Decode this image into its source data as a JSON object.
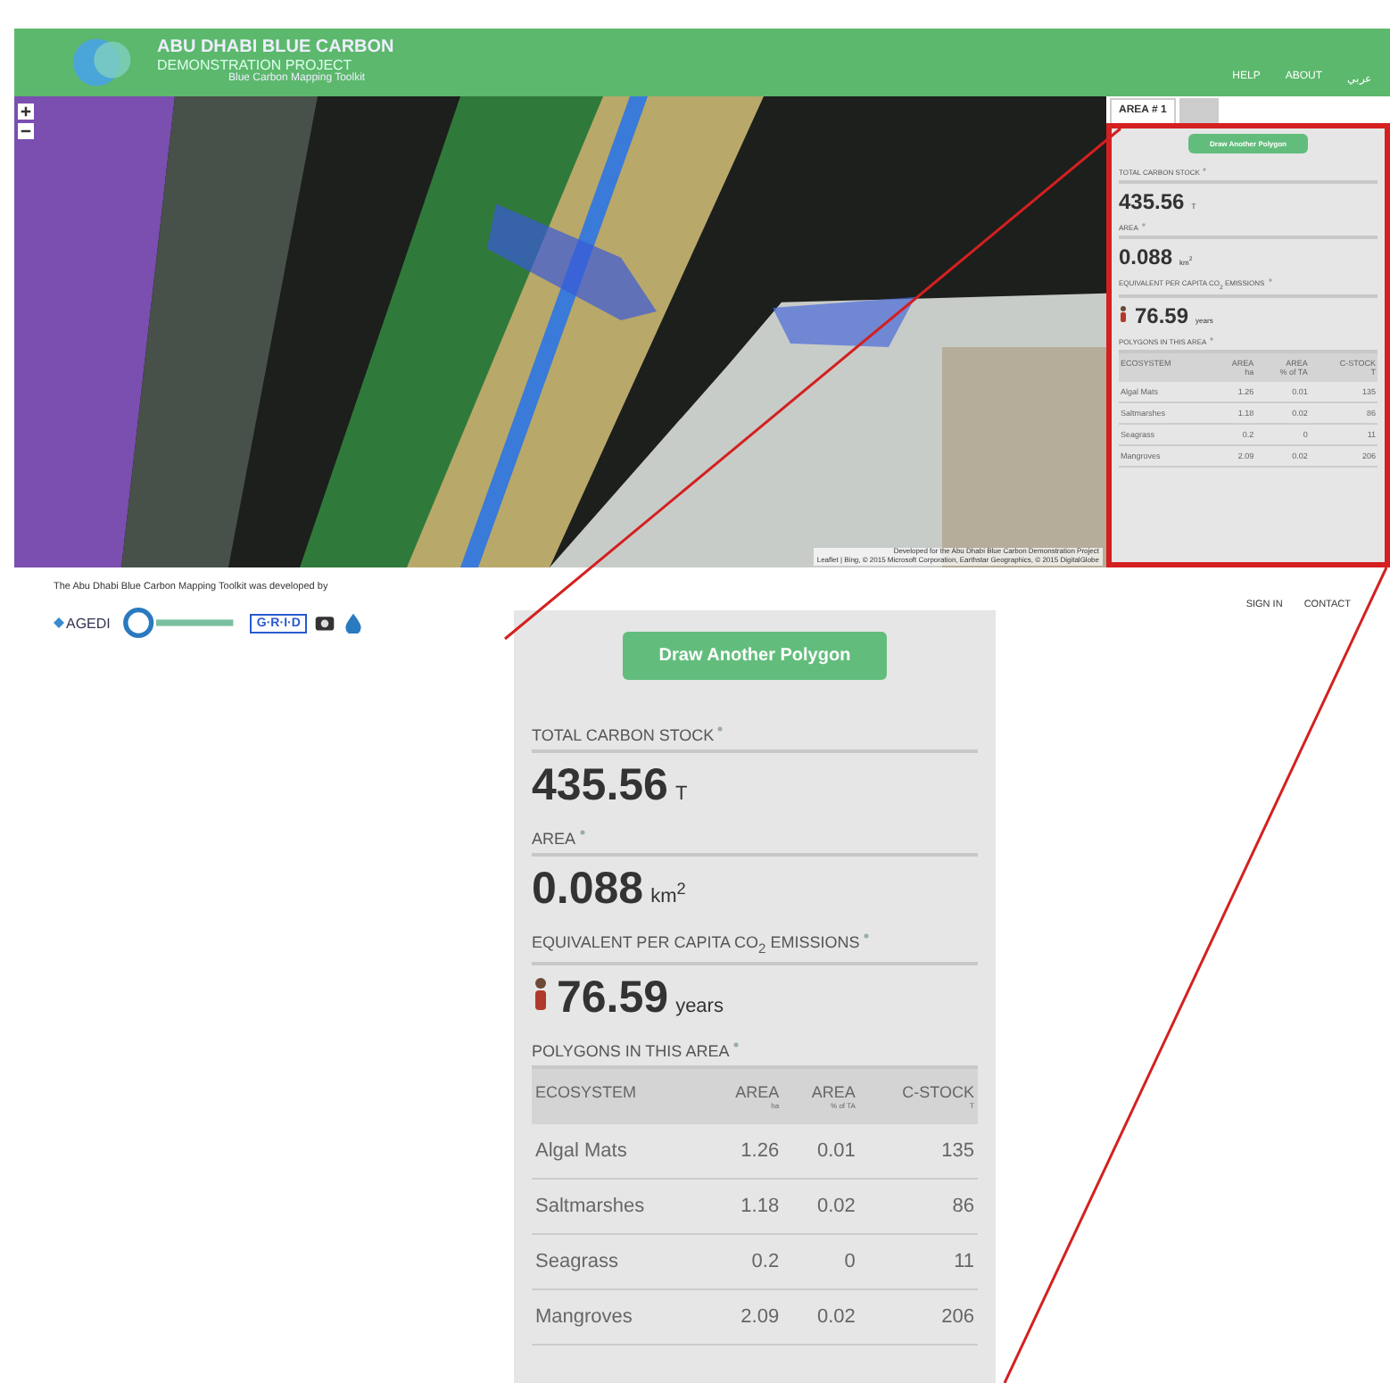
{
  "header": {
    "logo_title": "ABU DHABI BLUE CARBON",
    "logo_subtitle": "DEMONSTRATION PROJECT",
    "logo_tagline": "Blue Carbon Mapping Toolkit",
    "nav": [
      "HELP",
      "ABOUT",
      "عربي"
    ]
  },
  "map": {
    "attribution_1": "Developed for the Abu Dhabi Blue Carbon Demonstration Project",
    "attribution_2": "Leaflet | Bing, © 2015 Microsoft Corporation, Earthstar Geographics, © 2015 DigitalGlobe"
  },
  "side_tabs": [
    {
      "label": "AREA # 1",
      "selected": true
    },
    {
      "selected": false
    }
  ],
  "side_panel": {
    "button": "Draw Another Polygon",
    "stock_label": "TOTAL CARBON STOCK",
    "stock_value": "435.56",
    "stock_unit": "T",
    "area_label": "AREA",
    "area_value": "0.088",
    "area_unit": "km$^{2}$",
    "emission_label": "EQUIVALENT PER CAPITA CO$_{2}$ EMISSIONS",
    "emission_value": "76.59",
    "emission_unit": "years",
    "polygons_label": "POLYGONS IN THIS AREA",
    "columns": [
      {
        "title": "ECOSYSTEM"
      },
      {
        "title": "AREA",
        "unit": "ha"
      },
      {
        "title": "AREA",
        "unit": "% of TA"
      },
      {
        "title": "C-STOCK",
        "unit": "T"
      }
    ],
    "rows": [
      [
        "Algal Mats",
        "1.26",
        "0.01",
        "135"
      ],
      [
        "Saltmarshes",
        "1.18",
        "0.02",
        "86"
      ],
      [
        "Seagrass",
        "0.2",
        "0",
        "11"
      ],
      [
        "Mangroves",
        "2.09",
        "0.02",
        "206"
      ]
    ]
  },
  "footer": {
    "credit": "The Abu Dhabi Blue Carbon Mapping Toolkit was developed by",
    "partners": [
      "AGEDI",
      "G·R·I·D"
    ],
    "links": [
      "SIGN IN",
      "CONTACT"
    ]
  },
  "zoom_panel": {
    "button": "Draw Another Polygon",
    "stock_label": "TOTAL CARBON STOCK",
    "stock_value": "435.56",
    "stock_unit": "T",
    "area_label": "AREA",
    "area_value": "0.088",
    "area_unit": "km$^{2}$",
    "emission_label": "EQUIVALENT PER CAPITA CO$_{2}$ EMISSIONS",
    "emission_value": "76.59",
    "emission_unit": "years",
    "polygons_label": "POLYGONS IN THIS AREA",
    "columns": [
      {
        "title": "ECOSYSTEM"
      },
      {
        "title": "AREA",
        "unit": "ha"
      },
      {
        "title": "AREA",
        "unit": "% of TA"
      },
      {
        "title": "C-STOCK",
        "unit": "T"
      }
    ],
    "rows": [
      [
        "Algal Mats",
        "1.26",
        "0.01",
        "135"
      ],
      [
        "Saltmarshes",
        "1.18",
        "0.02",
        "86"
      ],
      [
        "Seagrass",
        "0.2",
        "0",
        "11"
      ],
      [
        "Mangroves",
        "2.09",
        "0.02",
        "206"
      ]
    ]
  }
}
